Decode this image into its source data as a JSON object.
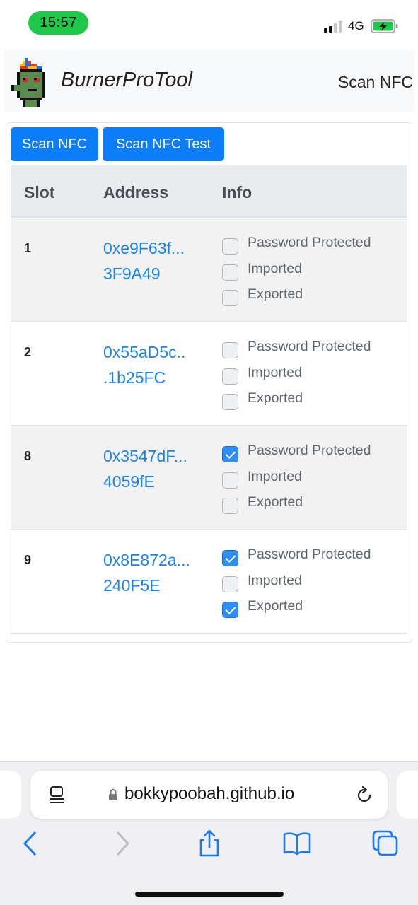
{
  "status": {
    "time": "15:57",
    "network": "4G",
    "time_color": "#1ec94a",
    "battery_charging": true
  },
  "navbar": {
    "brand": "BurnerProTool",
    "nav_link": "Scan NFC",
    "logo_icon": "pixel-punk-logo"
  },
  "actions": {
    "scan_nfc": "Scan NFC",
    "scan_nfc_test": "Scan NFC Test",
    "accent": "#0d7ef9"
  },
  "table": {
    "headers": [
      "Slot",
      "Address",
      "Info"
    ],
    "check_labels": [
      "Password Protected",
      "Imported",
      "Exported"
    ],
    "rows": [
      {
        "slot": "1",
        "address_line1": "0xe9F63f...",
        "address_line2": "3F9A49",
        "password_protected": false,
        "imported": false,
        "exported": false
      },
      {
        "slot": "2",
        "address_line1": "0x55aD5c..",
        "address_line2": ".1b25FC",
        "password_protected": false,
        "imported": false,
        "exported": false
      },
      {
        "slot": "8",
        "address_line1": "0x3547dF...",
        "address_line2": "4059fE",
        "password_protected": true,
        "imported": false,
        "exported": false
      },
      {
        "slot": "9",
        "address_line1": "0x8E872a...",
        "address_line2": "240F5E",
        "password_protected": true,
        "imported": false,
        "exported": true
      }
    ]
  },
  "browser": {
    "url": "bokkypoobah.github.io",
    "toolbar_icons": [
      "back-icon",
      "forward-icon",
      "share-icon",
      "bookmarks-icon",
      "tabs-icon"
    ]
  }
}
